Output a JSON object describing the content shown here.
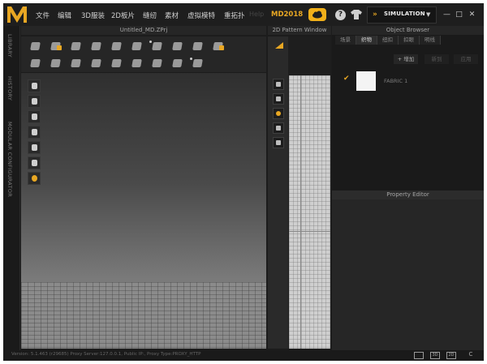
{
  "menubar": {
    "items": [
      "文件",
      "编辑",
      "3D服装",
      "2D板片",
      "缝纫",
      "素材",
      "虚拟模特",
      "重拓扑"
    ],
    "ghost_text": "Help",
    "version": "MD2018",
    "simulation_label": "SIMULATION"
  },
  "left_tabs": [
    "LIBRARY",
    "HISTORY",
    "MODULAR CONFIGURATOR"
  ],
  "viewport": {
    "title": "Untitled_MD.ZPrj"
  },
  "pattern_window": {
    "title": "2D Pattern Window"
  },
  "object_browser": {
    "title": "Object Browser",
    "tabs": [
      "场景",
      "织物",
      "纽扣",
      "扣眼",
      "明线"
    ],
    "active_tab": "织物",
    "add_label": "+ 增加",
    "new_label": "新到",
    "apply_label": "应用",
    "fabric_name": "FABRIC 1",
    "fabric_color": "#f4f4f4"
  },
  "property_editor": {
    "title": "Property Editor"
  },
  "status": {
    "text": "Version: 5.1.463 (r29685)      Proxy Server:127.0.0.1, Public IP:, Proxy Type:PROXY_HTTP",
    "view_buttons": [
      "",
      "3D",
      "2D",
      "C"
    ]
  },
  "colors": {
    "accent": "#e8a723",
    "background": "#1c1c1c"
  }
}
